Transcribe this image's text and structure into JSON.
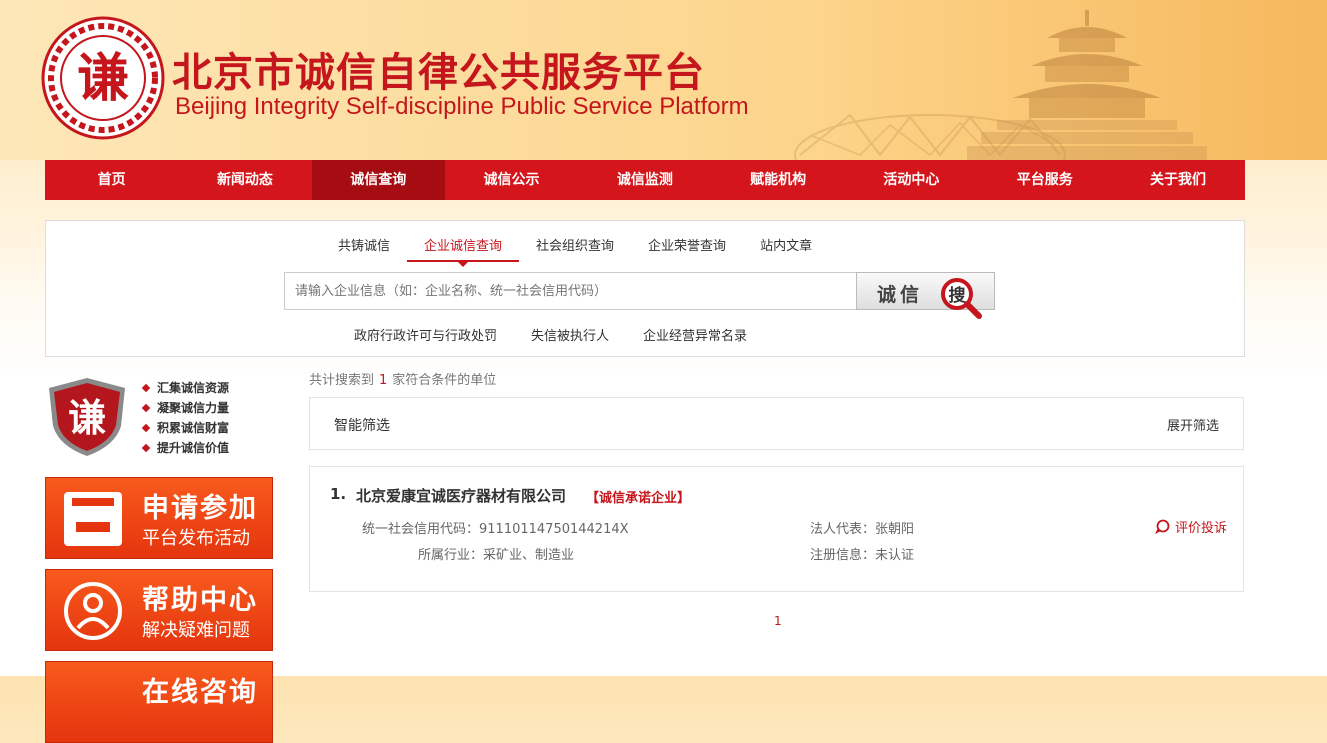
{
  "header": {
    "title_cn": "北京市诚信自律公共服务平台",
    "title_en": "Beijing Integrity Self-discipline Public Service Platform",
    "logo_char": "谦"
  },
  "nav": {
    "items": [
      {
        "label": "首页"
      },
      {
        "label": "新闻动态"
      },
      {
        "label": "诚信查询",
        "active": true
      },
      {
        "label": "诚信公示"
      },
      {
        "label": "诚信监测"
      },
      {
        "label": "赋能机构"
      },
      {
        "label": "活动中心"
      },
      {
        "label": "平台服务"
      },
      {
        "label": "关于我们"
      }
    ]
  },
  "search": {
    "tabs": [
      {
        "label": "共铸诚信"
      },
      {
        "label": "企业诚信查询",
        "active": true
      },
      {
        "label": "社会组织查询"
      },
      {
        "label": "企业荣誉查询"
      },
      {
        "label": "站内文章"
      }
    ],
    "placeholder": "请输入企业信息（如：企业名称、统一社会信用代码）",
    "button_text": "诚信",
    "button_icon_char": "搜",
    "quick_links": [
      "政府行政许可与行政处罚",
      "失信被执行人",
      "企业经营异常名录"
    ]
  },
  "sidebar": {
    "logo_char": "谦",
    "slogans": [
      "汇集诚信资源",
      "凝聚诚信力量",
      "积累诚信财富",
      "提升诚信价值"
    ],
    "promos": [
      {
        "title": "申请参加",
        "subtitle": "平台发布活动"
      },
      {
        "title": "帮助中心",
        "subtitle": "解决疑难问题"
      },
      {
        "title": "在线咨询",
        "subtitle": ""
      }
    ]
  },
  "results": {
    "count_prefix": "共计搜索到",
    "count": "1",
    "count_suffix": "家符合条件的单位",
    "filter_label": "智能筛选",
    "filter_expand": "展开筛选",
    "items": [
      {
        "index": "1.",
        "name": "北京爱康宜诚医疗器材有限公司",
        "badge": "【诚信承诺企业】",
        "credit_code_label": "统一社会信用代码：",
        "credit_code": "91110114750144214X",
        "industry_label": "所属行业：",
        "industry": "采矿业、制造业",
        "legal_rep_label": "法人代表：",
        "legal_rep": "张朝阳",
        "reg_label": "注册信息：",
        "reg": "未认证",
        "eval_label": "评价投诉"
      }
    ],
    "page": "1"
  },
  "colors": {
    "brand_red": "#d4161c",
    "nav_active": "#a60d12",
    "promo_orange": "#f04a15"
  }
}
